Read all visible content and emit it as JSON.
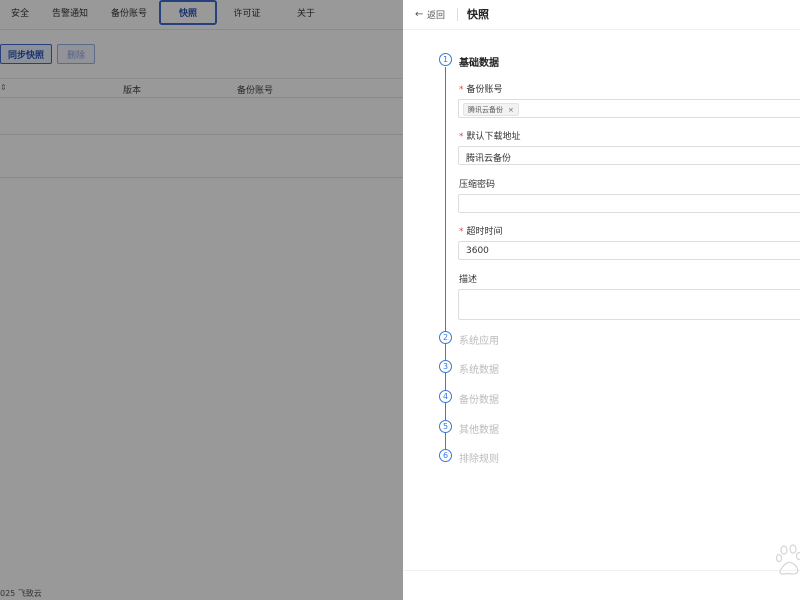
{
  "tabs": [
    {
      "label": "安全",
      "active": false
    },
    {
      "label": "告警通知",
      "active": false
    },
    {
      "label": "备份账号",
      "active": false
    },
    {
      "label": "快照",
      "active": true
    },
    {
      "label": "许可证",
      "active": false
    },
    {
      "label": "关于",
      "active": false
    }
  ],
  "toolbar": {
    "sync_label": "同步快照",
    "delete_label": "删除"
  },
  "table": {
    "columns": [
      "版本",
      "备份账号"
    ]
  },
  "footer": {
    "text": "025 飞致云"
  },
  "drawer": {
    "back_label": "返回",
    "title": "快照",
    "steps": [
      {
        "num": "1",
        "label": "基础数据"
      },
      {
        "num": "2",
        "label": "系统应用"
      },
      {
        "num": "3",
        "label": "系统数据"
      },
      {
        "num": "4",
        "label": "备份数据"
      },
      {
        "num": "5",
        "label": "其他数据"
      },
      {
        "num": "6",
        "label": "排除规则"
      }
    ],
    "form": {
      "backup_account": {
        "label": "备份账号",
        "tag": "腾讯云备份",
        "tag_close": "×"
      },
      "download_url": {
        "label": "默认下载地址",
        "value": "腾讯云备份"
      },
      "compress_password": {
        "label": "压缩密码",
        "value": ""
      },
      "timeout": {
        "label": "超时时间",
        "value": "3600"
      },
      "description": {
        "label": "描述",
        "value": ""
      }
    },
    "required_mark": "*"
  },
  "colors": {
    "accent": "#3a78d8",
    "active_tab": "#3f6bd1",
    "required": "#e24a4a"
  }
}
